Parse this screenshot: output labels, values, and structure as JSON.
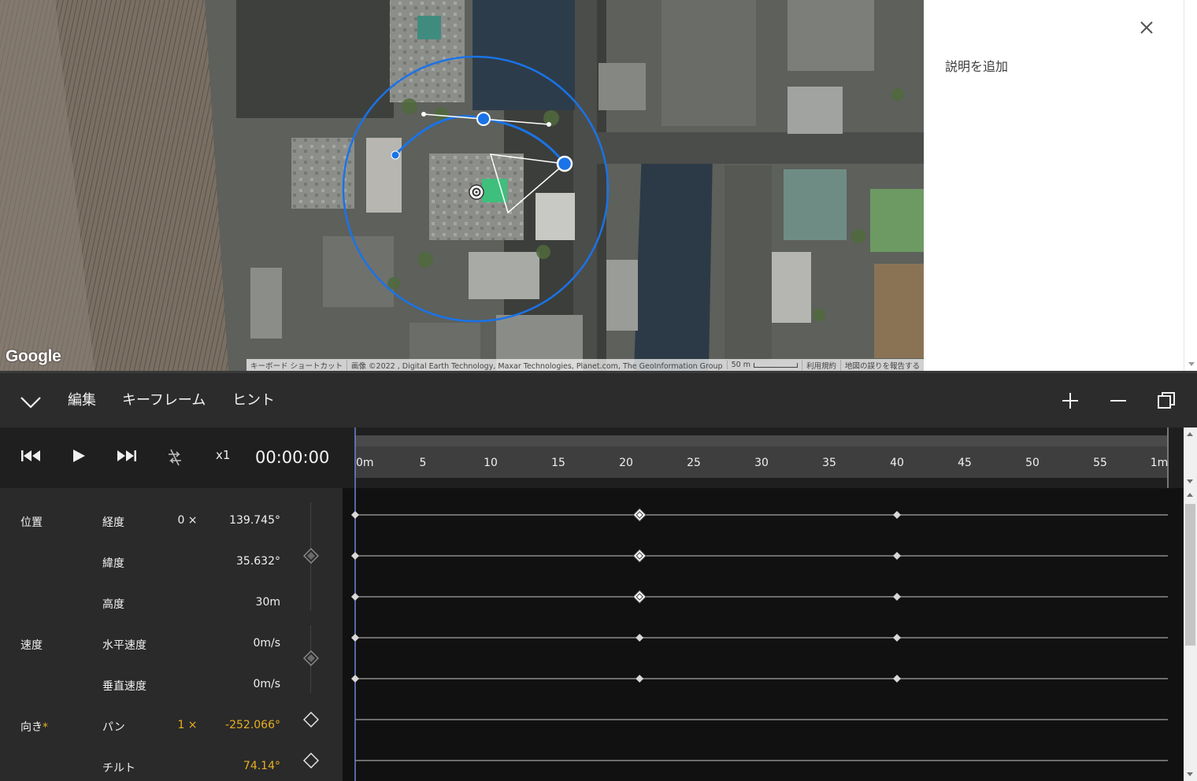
{
  "map": {
    "logo": "Google",
    "attribution": {
      "shortcuts": "キーボード ショートカット",
      "imagery": "画像 ©2022 , Digital Earth Technology, Maxar Technologies, Planet.com, The GeoInformation Group",
      "scale": "50 m",
      "terms": "利用規約",
      "report": "地図の誤りを報告する"
    }
  },
  "description_panel": {
    "add_description": "説明を追加",
    "close_icon": "close-icon"
  },
  "menubar": {
    "collapse_icon": "chevron-down-icon",
    "items": [
      "編集",
      "キーフレーム",
      "ヒント"
    ],
    "tools": [
      "plus-icon",
      "minus-icon",
      "restore-window-icon"
    ]
  },
  "transport": {
    "buttons": [
      "skip-to-start-icon",
      "play-icon",
      "skip-to-end-icon",
      "loop-off-icon"
    ],
    "speed": "x1",
    "timecode": "00:00:00"
  },
  "timeline": {
    "ticks": [
      "0m",
      "5",
      "10",
      "15",
      "20",
      "25",
      "30",
      "35",
      "40",
      "45",
      "50",
      "55",
      "1m"
    ],
    "playhead_seconds": 0,
    "keyframes_seconds": [
      0,
      21,
      40
    ]
  },
  "properties": {
    "groups": [
      {
        "label": "位置",
        "rows": [
          {
            "name": "経度",
            "multiplier": "0 ×",
            "value": "139.745°"
          },
          {
            "name": "緯度",
            "multiplier": "",
            "value": "35.632°"
          },
          {
            "name": "高度",
            "multiplier": "",
            "value": "30m"
          }
        ]
      },
      {
        "label": "速度",
        "rows": [
          {
            "name": "水平速度",
            "multiplier": "",
            "value": "0m/s"
          },
          {
            "name": "垂直速度",
            "multiplier": "",
            "value": "0m/s"
          }
        ]
      },
      {
        "label": "向き",
        "modified_marker": "*",
        "rows": [
          {
            "name": "パン",
            "multiplier": "1 ×",
            "value": "-252.066°"
          },
          {
            "name": "チルト",
            "multiplier": "",
            "value": "74.14°"
          }
        ]
      }
    ]
  },
  "colors": {
    "accent_blue": "#1a73e8",
    "highlight_yellow": "#e8b01e"
  }
}
